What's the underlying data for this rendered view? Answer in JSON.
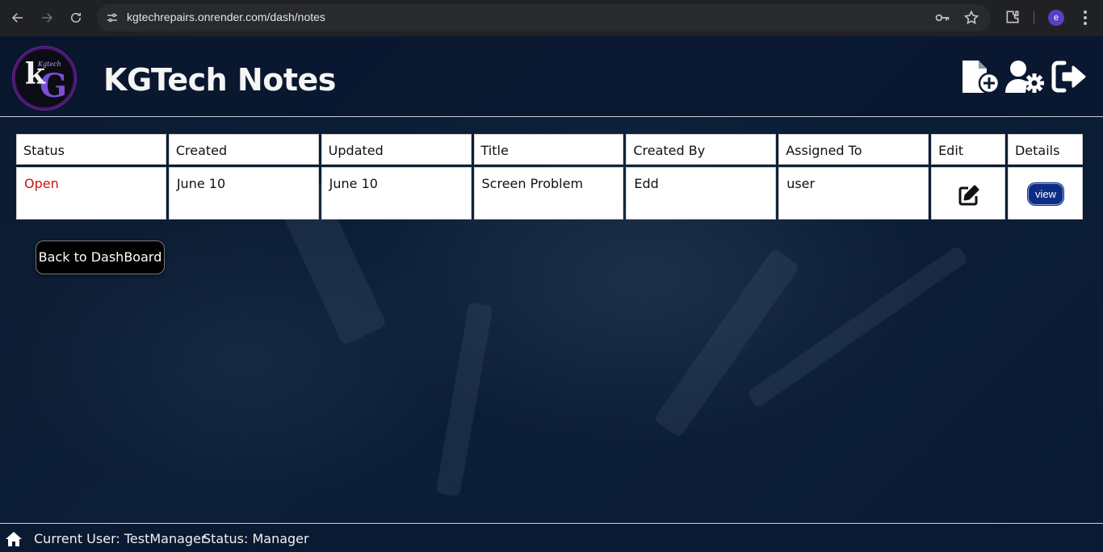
{
  "browser": {
    "url": "kgtechrepairs.onrender.com/dash/notes",
    "profile_initial": "e"
  },
  "header": {
    "logo_letter_k": "k",
    "logo_letter_g": "G",
    "logo_tagline": "Kgtech",
    "title": "KGTech Notes"
  },
  "table": {
    "columns": [
      "Status",
      "Created",
      "Updated",
      "Title",
      "Created By",
      "Assigned To",
      "Edit",
      "Details"
    ],
    "rows": [
      {
        "status": "Open",
        "created": "June 10",
        "updated": "June 10",
        "title": "Screen Problem",
        "created_by": "Edd",
        "assigned_to": "user",
        "details_label": "view"
      }
    ]
  },
  "back_button": "Back to DashBoard",
  "footer": {
    "current_user": "Current User: TestManager",
    "status": "Status: Manager"
  },
  "colors": {
    "status_open": "#c41414",
    "view_button": "#0c2d83",
    "background": "#0a1a33"
  },
  "icons": [
    "back-arrow-icon",
    "forward-arrow-icon",
    "reload-icon",
    "site-settings-icon",
    "key-icon",
    "star-icon",
    "extensions-icon",
    "menu-icon",
    "new-note-icon",
    "user-settings-icon",
    "logout-icon",
    "edit-icon",
    "home-icon"
  ]
}
